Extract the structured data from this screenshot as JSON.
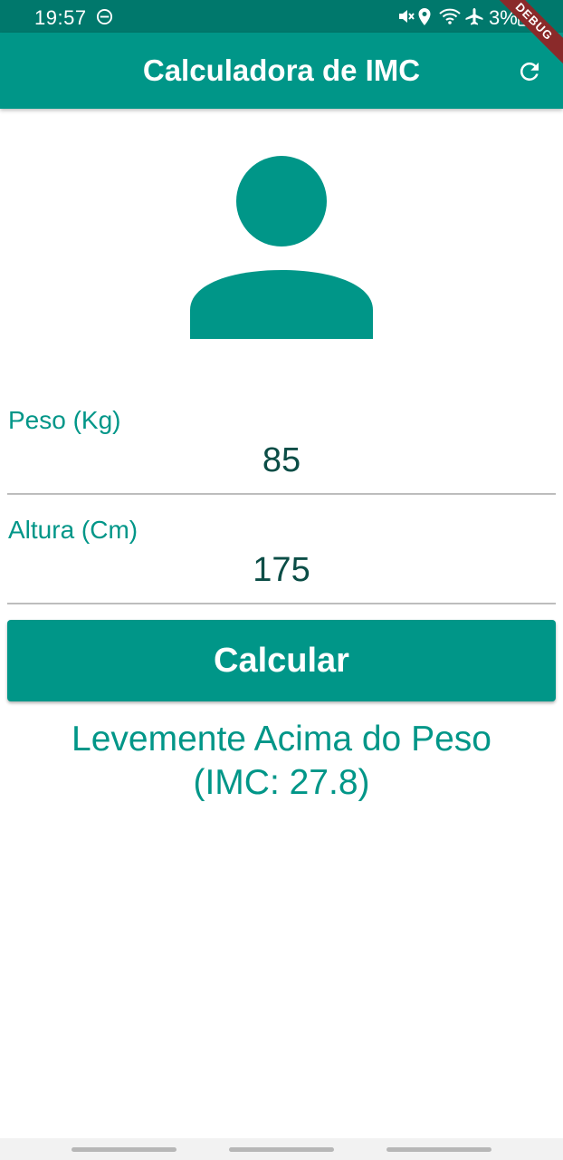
{
  "status_bar": {
    "time": "19:57",
    "battery_text": "3%",
    "icons": [
      "do-not-disturb-icon",
      "mute-icon",
      "location-icon",
      "wifi-icon",
      "airplane-mode-icon",
      "battery-icon"
    ]
  },
  "debug_banner": "DEBUG",
  "app_bar": {
    "title": "Calculadora de IMC",
    "refresh_icon": "refresh-icon"
  },
  "colors": {
    "primary": "#009688",
    "status_bar": "#00786c",
    "input_text": "#0b4d46",
    "divider": "#bdbdbd",
    "debug_banner": "#8a2a2a"
  },
  "avatar_icon": "person-icon",
  "form": {
    "weight": {
      "label": "Peso (Kg)",
      "value": "85"
    },
    "height": {
      "label": "Altura (Cm)",
      "value": "175"
    },
    "calculate_label": "Calcular"
  },
  "result": {
    "text": "Levemente Acima do Peso\n(IMC: 27.8)"
  }
}
